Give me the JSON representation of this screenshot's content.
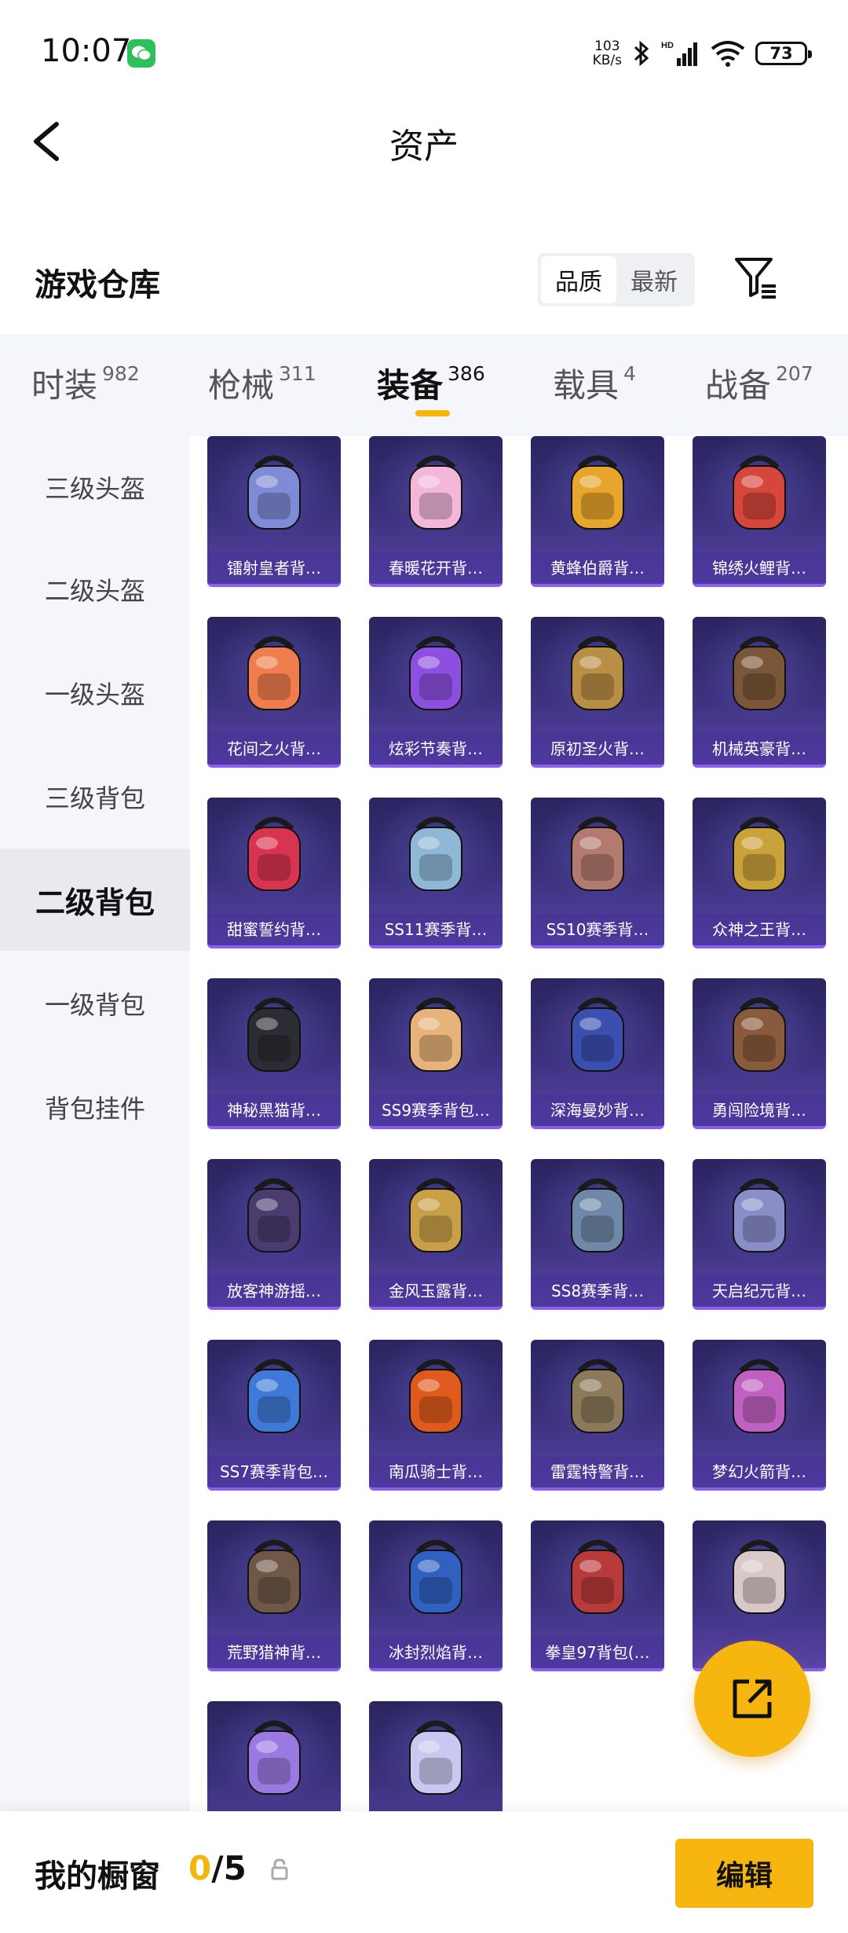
{
  "status_bar": {
    "time": "10:07",
    "net_speed_value": "103",
    "net_speed_unit": "KB/s",
    "battery": "73"
  },
  "header": {
    "title": "资产"
  },
  "section": {
    "title": "游戏仓库",
    "sort_options": [
      "品质",
      "最新"
    ],
    "active_sort": "品质"
  },
  "tabs": [
    {
      "label": "时装",
      "count": "982"
    },
    {
      "label": "枪械",
      "count": "311"
    },
    {
      "label": "装备",
      "count": "386"
    },
    {
      "label": "载具",
      "count": "4"
    },
    {
      "label": "战备",
      "count": "207"
    }
  ],
  "active_tab": "装备",
  "sidebar": {
    "items": [
      "三级头盔",
      "二级头盔",
      "一级头盔",
      "三级背包",
      "二级背包",
      "一级背包",
      "背包挂件"
    ],
    "active": "二级背包"
  },
  "items": [
    {
      "label": "镭射皇者背…",
      "accent": "#7f8bd6"
    },
    {
      "label": "春暖花开背…",
      "accent": "#f3b7d9"
    },
    {
      "label": "黄蜂伯爵背…",
      "accent": "#e7a52b"
    },
    {
      "label": "锦绣火鲤背…",
      "accent": "#d6463b"
    },
    {
      "label": "花间之火背…",
      "accent": "#f07e4d"
    },
    {
      "label": "炫彩节奏背…",
      "accent": "#8d4fe0"
    },
    {
      "label": "原初圣火背…",
      "accent": "#b98e45"
    },
    {
      "label": "机械英豪背…",
      "accent": "#7b5638"
    },
    {
      "label": "甜蜜誓约背…",
      "accent": "#d8344f"
    },
    {
      "label": "SS11赛季背…",
      "accent": "#8fb7d6"
    },
    {
      "label": "SS10赛季背…",
      "accent": "#b37a6f"
    },
    {
      "label": "众神之王背…",
      "accent": "#c9a23a"
    },
    {
      "label": "神秘黑猫背…",
      "accent": "#2c2c34"
    },
    {
      "label": "SS9赛季背包…",
      "accent": "#e6b37a"
    },
    {
      "label": "深海曼妙背…",
      "accent": "#3a4fb0"
    },
    {
      "label": "勇闯险境背…",
      "accent": "#8a5a3c"
    },
    {
      "label": "放客神游摇…",
      "accent": "#4a3c6e"
    },
    {
      "label": "金风玉露背…",
      "accent": "#c9a048"
    },
    {
      "label": "SS8赛季背…",
      "accent": "#6f88a8"
    },
    {
      "label": "天启纪元背…",
      "accent": "#8a8ec8"
    },
    {
      "label": "SS7赛季背包…",
      "accent": "#3f7ad8"
    },
    {
      "label": "南瓜骑士背…",
      "accent": "#e05a1e"
    },
    {
      "label": "雷霆特警背…",
      "accent": "#8c7a5a"
    },
    {
      "label": "梦幻火箭背…",
      "accent": "#c060c0"
    },
    {
      "label": "荒野猎神背…",
      "accent": "#6f5848"
    },
    {
      "label": "冰封烈焰背…",
      "accent": "#3060c0"
    },
    {
      "label": "拳皇97背包(…",
      "accent": "#b83a3a"
    },
    {
      "label": "",
      "accent": "#d8c8c8"
    },
    {
      "label": "",
      "accent": "#9a7ae0"
    },
    {
      "label": "",
      "accent": "#c8c8f0"
    }
  ],
  "showcase": {
    "title": "我的橱窗",
    "current": "0",
    "total": "/5",
    "edit_label": "编辑"
  }
}
